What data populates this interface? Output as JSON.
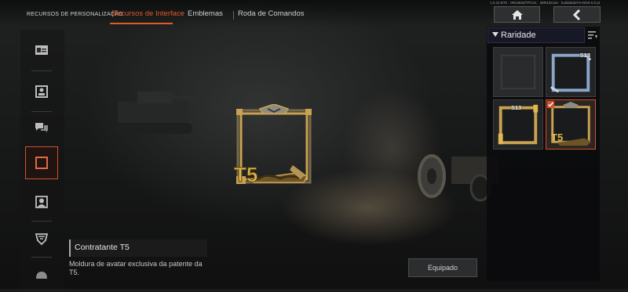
{
  "header": {
    "tabs": [
      {
        "label": "RECURSOS DE PERSONALIZAÇÃO",
        "active": false
      },
      {
        "label": "Recursos de Interface",
        "active": true
      },
      {
        "label": "Emblemas",
        "active": false
      },
      {
        "label": "Roda de Comandos",
        "active": false
      }
    ],
    "version_text": "1.0.24.BT0 · 0R23820/TPC01 · 38R432182 · buildabdef-5-0019-0.0 pt",
    "home_icon": "home-icon",
    "back_icon": "chevron-left-icon"
  },
  "sidebar": {
    "items": [
      {
        "icon": "id-card-icon",
        "selected": false
      },
      {
        "icon": "profile-photo-icon",
        "selected": false
      },
      {
        "icon": "chat-bubbles-icon",
        "selected": false
      },
      {
        "icon": "frame-icon",
        "selected": true
      },
      {
        "icon": "portrait-icon",
        "selected": false
      },
      {
        "icon": "badge-icon",
        "selected": false
      },
      {
        "icon": "helmet-icon",
        "selected": false
      }
    ]
  },
  "detail": {
    "title": "Contratante T5",
    "description": "Moldura de avatar exclusiva da patente da T5.",
    "rank_label": "T5",
    "equip_label": "Equipado"
  },
  "panel": {
    "header_label": "Raridade",
    "sort_icon": "sort-icon",
    "items": [
      {
        "badge": "",
        "rarity": "empty",
        "selected": false
      },
      {
        "badge": "S13",
        "rarity": "blue",
        "selected": false
      },
      {
        "badge": "S13",
        "rarity": "gold",
        "selected": false
      },
      {
        "badge": "T5",
        "rarity": "gold",
        "selected": true
      }
    ]
  },
  "colors": {
    "accent": "#d2502b",
    "gold": "#c9a253",
    "blue": "#8aa6c8"
  }
}
